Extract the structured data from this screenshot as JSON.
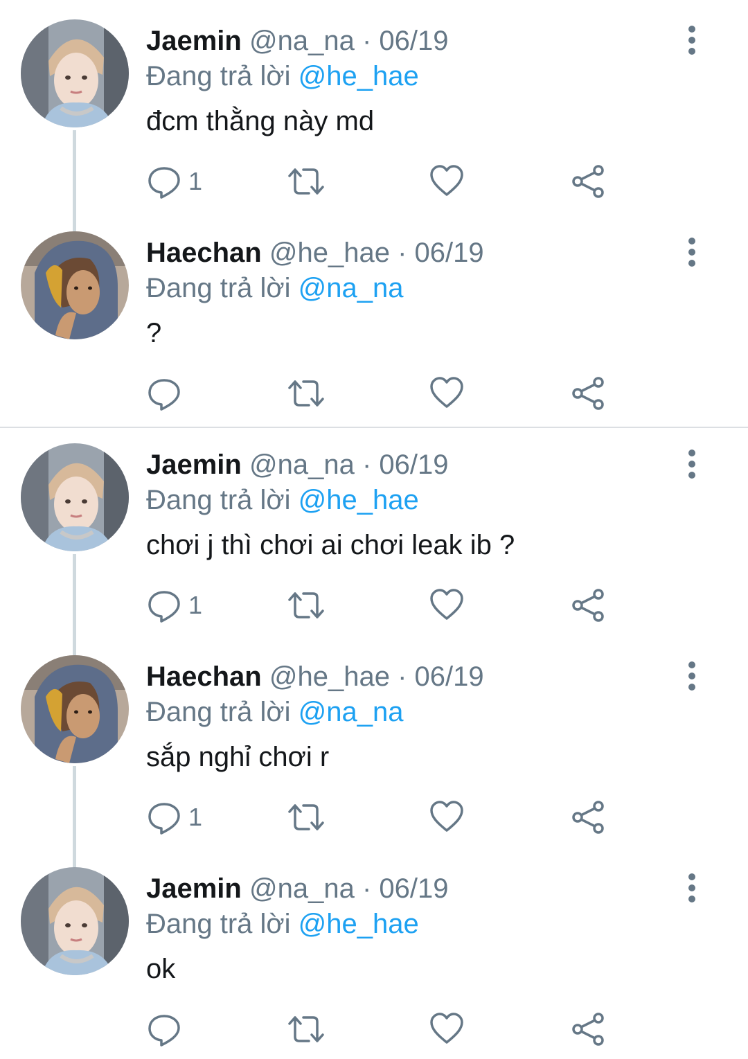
{
  "colors": {
    "text": "#14171a",
    "secondary": "#657786",
    "link": "#1da1f2",
    "thread_line": "#cfd9de"
  },
  "reply_prefix": "Đang trả lời",
  "tweets": [
    {
      "name": "Jaemin",
      "handle": "@na_na",
      "separator": "·",
      "date": "06/19",
      "reply_to": "@he_hae",
      "text": "đcm thằng này md",
      "reply_count": "1",
      "avatar": "jaemin-avatar",
      "icons": [
        "reply-icon",
        "retweet-icon",
        "like-icon",
        "share-icon",
        "more-icon"
      ]
    },
    {
      "name": "Haechan",
      "handle": "@he_hae",
      "separator": "·",
      "date": "06/19",
      "reply_to": "@na_na",
      "text": "?",
      "reply_count": "",
      "avatar": "haechan-avatar"
    },
    {
      "name": "Jaemin",
      "handle": "@na_na",
      "separator": "·",
      "date": "06/19",
      "reply_to": "@he_hae",
      "text": "chơi j thì chơi ai chơi leak ib ?",
      "reply_count": "1",
      "avatar": "jaemin-avatar"
    },
    {
      "name": "Haechan",
      "handle": "@he_hae",
      "separator": "·",
      "date": "06/19",
      "reply_to": "@na_na",
      "text": "sắp nghỉ chơi r",
      "reply_count": "1",
      "avatar": "haechan-avatar"
    },
    {
      "name": "Jaemin",
      "handle": "@na_na",
      "separator": "·",
      "date": "06/19",
      "reply_to": "@he_hae",
      "text": "ok",
      "reply_count": "",
      "avatar": "jaemin-avatar"
    }
  ]
}
